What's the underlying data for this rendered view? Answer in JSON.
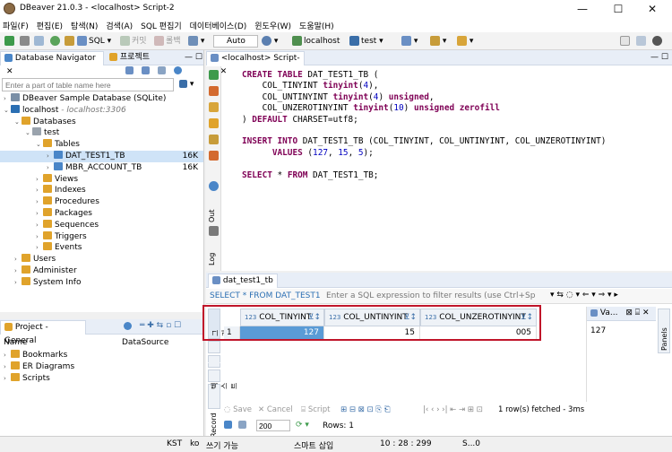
{
  "window": {
    "title": "DBeaver 21.0.3 - <localhost> Script-2",
    "minimize": "—",
    "maximize": "☐",
    "close": "✕"
  },
  "menu": [
    "파일(F)",
    "편집(E)",
    "탐색(N)",
    "검색(A)",
    "SQL 편집기",
    "데이터베이스(D)",
    "윈도우(W)",
    "도움말(H)"
  ],
  "toolbar": {
    "sql_label": "SQL",
    "commit_label": "커밋",
    "rollback_label": "롤백",
    "tx_mode": "Auto",
    "datasource": "localhost",
    "schema": "test"
  },
  "navigator": {
    "tab_label": "Database Navigator",
    "tab_close": "✕",
    "project_tab_label": "프로젝트",
    "filter_placeholder": "Enter a part of table name here",
    "tree": [
      {
        "label": "DBeaver Sample Database (SQLite)",
        "level": 0,
        "twisty": "›",
        "icon_color": "#7a8fa6"
      },
      {
        "label": "localhost",
        "sub": " - localhost:3306",
        "level": 0,
        "twisty": "⌄",
        "icon_color": "#2b6fb3"
      },
      {
        "label": "Databases",
        "level": 1,
        "twisty": "⌄",
        "icon_color": "#e0a32b"
      },
      {
        "label": "test",
        "level": 2,
        "twisty": "⌄",
        "icon_color": "#9aa3ad"
      },
      {
        "label": "Tables",
        "level": 3,
        "twisty": "⌄",
        "icon_color": "#e0a32b"
      },
      {
        "label": "DAT_TEST1_TB",
        "level": 4,
        "twisty": "›",
        "icon_color": "#4a86c8",
        "size": "16K",
        "selected": true
      },
      {
        "label": "MBR_ACCOUNT_TB",
        "level": 4,
        "twisty": "›",
        "icon_color": "#4a86c8",
        "size": "16K"
      },
      {
        "label": "Views",
        "level": 3,
        "twisty": "›",
        "icon_color": "#e0a32b"
      },
      {
        "label": "Indexes",
        "level": 3,
        "twisty": "›",
        "icon_color": "#e0a32b"
      },
      {
        "label": "Procedures",
        "level": 3,
        "twisty": "›",
        "icon_color": "#e0a32b"
      },
      {
        "label": "Packages",
        "level": 3,
        "twisty": "›",
        "icon_color": "#e0a32b"
      },
      {
        "label": "Sequences",
        "level": 3,
        "twisty": "›",
        "icon_color": "#e0a32b"
      },
      {
        "label": "Triggers",
        "level": 3,
        "twisty": "›",
        "icon_color": "#e0a32b"
      },
      {
        "label": "Events",
        "level": 3,
        "twisty": "›",
        "icon_color": "#e0a32b"
      },
      {
        "label": "Users",
        "level": 1,
        "twisty": "›",
        "icon_color": "#e0a32b"
      },
      {
        "label": "Administer",
        "level": 1,
        "twisty": "›",
        "icon_color": "#e0a32b"
      },
      {
        "label": "System Info",
        "level": 1,
        "twisty": "›",
        "icon_color": "#e0a32b"
      }
    ]
  },
  "project": {
    "tab_label": "Project - General",
    "col_name": "Name",
    "col_datasource": "DataSource",
    "items": [
      "Bookmarks",
      "ER Diagrams",
      "Scripts"
    ]
  },
  "editor": {
    "tab_label": "<localhost> Script-2",
    "gutter_out": "Out",
    "gutter_log": "Log",
    "code": [
      [
        [
          "kw",
          "CREATE TABLE"
        ],
        [
          "t",
          " DAT_TEST1_TB ("
        ]
      ],
      [
        [
          "t",
          "    COL_TINYINT "
        ],
        [
          "kw",
          "tinyint"
        ],
        [
          "t",
          "("
        ],
        [
          "num",
          "4"
        ],
        [
          "t",
          "),"
        ]
      ],
      [
        [
          "t",
          "    COL_UNTINYINT "
        ],
        [
          "kw",
          "tinyint"
        ],
        [
          "t",
          "("
        ],
        [
          "num",
          "4"
        ],
        [
          "t",
          ") "
        ],
        [
          "kw",
          "unsigned"
        ],
        [
          "t",
          ","
        ]
      ],
      [
        [
          "t",
          "    COL_UNZEROTINYINT "
        ],
        [
          "kw",
          "tinyint"
        ],
        [
          "t",
          "("
        ],
        [
          "num",
          "10"
        ],
        [
          "t",
          ") "
        ],
        [
          "kw",
          "unsigned zerofill"
        ]
      ],
      [
        [
          "t",
          ") "
        ],
        [
          "kw",
          "DEFAULT"
        ],
        [
          "t",
          " CHARSET=utf8;"
        ]
      ],
      [
        [
          "t",
          ""
        ]
      ],
      [
        [
          "kw",
          "INSERT INTO"
        ],
        [
          "t",
          " DAT_TEST1_TB (COL_TINYINT, COL_UNTINYINT, COL_UNZEROTINYINT)"
        ]
      ],
      [
        [
          "t",
          "      "
        ],
        [
          "kw",
          "VALUES"
        ],
        [
          "t",
          " ("
        ],
        [
          "num",
          "127"
        ],
        [
          "t",
          ", "
        ],
        [
          "num",
          "15"
        ],
        [
          "t",
          ", "
        ],
        [
          "num",
          "5"
        ],
        [
          "t",
          ");"
        ]
      ],
      [
        [
          "t",
          ""
        ]
      ],
      [
        [
          "kw",
          "SELECT"
        ],
        [
          "t",
          " * "
        ],
        [
          "kw",
          "FROM"
        ],
        [
          "t",
          " DAT_TEST1_TB;"
        ]
      ]
    ]
  },
  "result": {
    "tab_label": "dat_test1_tb 1",
    "query_preview": "SELECT * FROM DAT_TEST1",
    "filter_placeholder": "Enter a SQL expression to filter results (use Ctrl+Sp",
    "grid_tab": "그리드",
    "text_tab": "텍스트",
    "record_tab": "Record",
    "columns": [
      {
        "type": "123",
        "name": "COL_TINYINT"
      },
      {
        "type": "123",
        "name": "COL_UNTINYINT"
      },
      {
        "type": "123",
        "name": "COL_UNZEROTINYINT"
      }
    ],
    "rows": [
      {
        "index": "1",
        "values": [
          "127",
          "15",
          "005"
        ]
      }
    ],
    "value_panel_label": "Va...",
    "value_panel_value": "127",
    "panels_label": "Panels",
    "save": "Save",
    "cancel": "Cancel",
    "script": "Script",
    "fetch_size": "200",
    "rows_label": "Rows: 1",
    "fetch_info": "1 row(s) fetched - 3ms"
  },
  "statusbar": {
    "tz": "KST",
    "lang": "ko",
    "mode": "쓰기 가능",
    "insert": "스마트 삽입",
    "position": "10 : 28 : 299",
    "sel": "S...0"
  }
}
